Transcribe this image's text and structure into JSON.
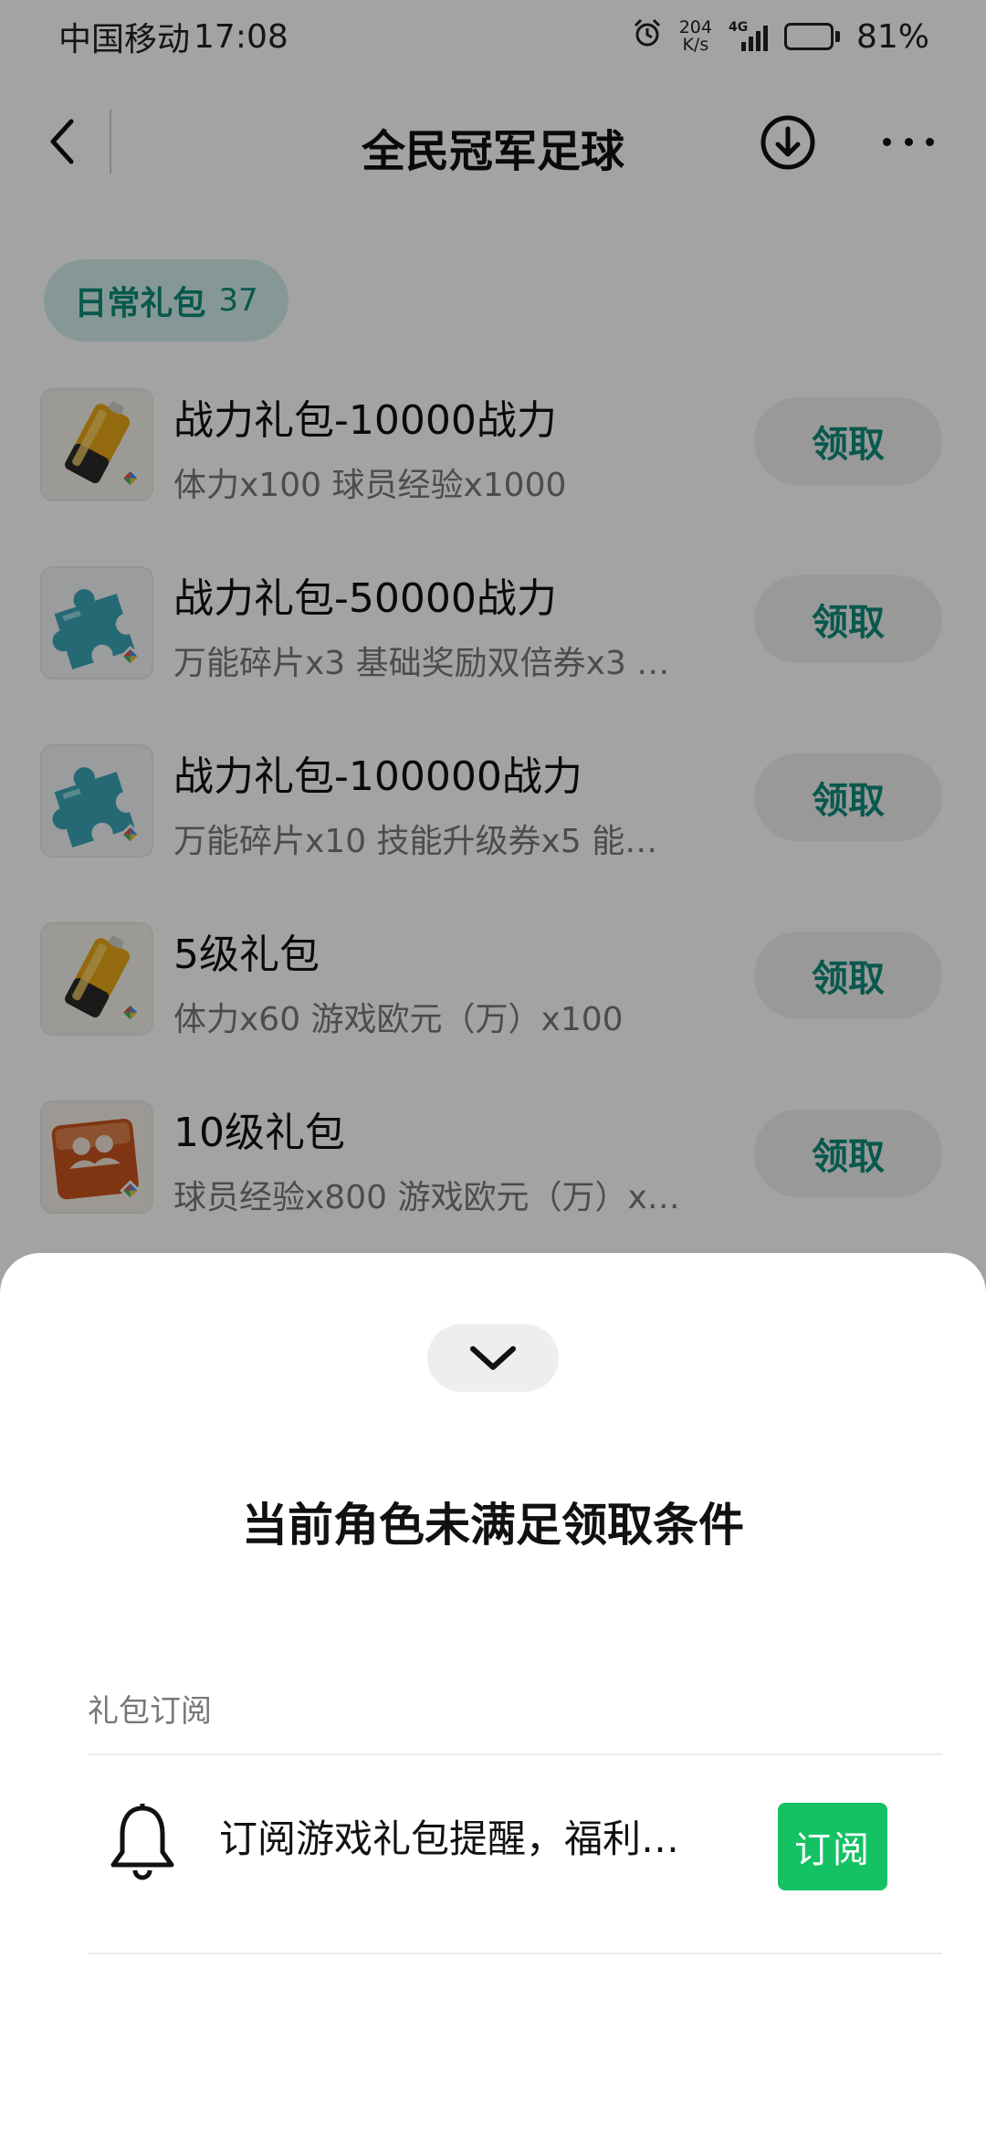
{
  "status_bar": {
    "carrier": "中国移动",
    "time": "17:08",
    "net_speed_value": "204",
    "net_speed_unit": "K/s",
    "network_type": "4G",
    "battery_percent": "81%",
    "battery_level": 0.81
  },
  "header": {
    "title": "全民冠军足球"
  },
  "category": {
    "label": "日常礼包",
    "count": "37"
  },
  "gifts": [
    {
      "name": "战力礼包-10000战力",
      "desc": "体力x100 球员经验x1000",
      "icon": "battery-icon",
      "button": "领取"
    },
    {
      "name": "战力礼包-50000战力",
      "desc": "万能碎片x3 基础奖励双倍券x3 …",
      "icon": "puzzle-icon",
      "button": "领取"
    },
    {
      "name": "战力礼包-100000战力",
      "desc": "万能碎片x10 技能升级券x5 能…",
      "icon": "puzzle-icon",
      "button": "领取"
    },
    {
      "name": "5级礼包",
      "desc": "体力x60 游戏欧元（万）x100",
      "icon": "battery-icon",
      "button": "领取"
    },
    {
      "name": "10级礼包",
      "desc": "球员经验x800 游戏欧元（万）x…",
      "icon": "exp-icon",
      "button": "领取"
    }
  ],
  "sheet": {
    "title": "当前角色未满足领取条件",
    "section_label": "礼包订阅",
    "subscription_text": "订阅游戏礼包提醒，福利…",
    "subscribe_button": "订阅"
  },
  "colors": {
    "accent": "#0d8a79",
    "chip_bg": "#d2eeea",
    "subscribe_green": "#14c264"
  }
}
